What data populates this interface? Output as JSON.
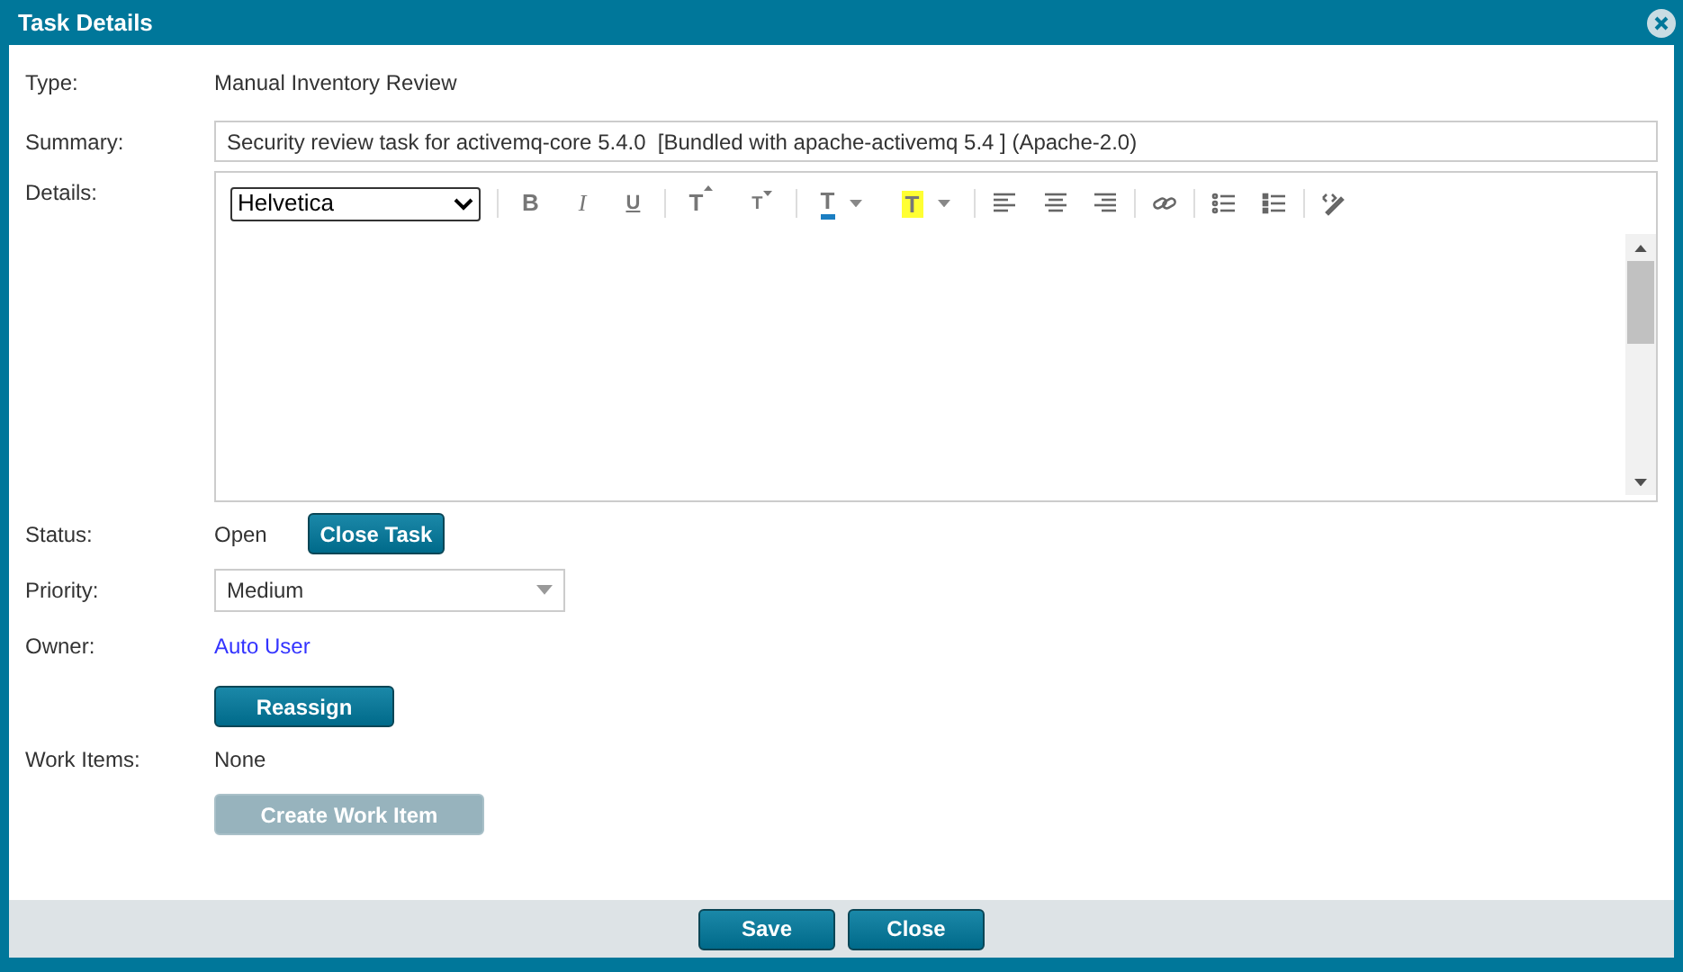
{
  "window": {
    "title": "Task Details"
  },
  "fields": {
    "type": {
      "label": "Type:",
      "value": "Manual Inventory Review"
    },
    "summary": {
      "label": "Summary:",
      "value": "Security review task for activemq-core 5.4.0  [Bundled with apache-activemq 5.4 ] (Apache-2.0)"
    },
    "details": {
      "label": "Details:",
      "font": "Helvetica",
      "toolbar": [
        [
          {
            "kind": "bold",
            "label": "B"
          },
          {
            "kind": "italic",
            "label": "I"
          },
          {
            "kind": "underline",
            "label": "U"
          }
        ],
        [
          {
            "kind": "grow",
            "label": "T"
          },
          {
            "kind": "shrink",
            "label": "T"
          }
        ],
        [
          {
            "kind": "text-color",
            "label": "T"
          },
          {
            "kind": "highlight",
            "label": "T"
          }
        ],
        [
          {
            "kind": "align-left"
          },
          {
            "kind": "align-center"
          },
          {
            "kind": "align-right"
          }
        ],
        [
          {
            "kind": "link"
          }
        ],
        [
          {
            "kind": "ordered-list"
          },
          {
            "kind": "bullet-list"
          }
        ],
        [
          {
            "kind": "source"
          }
        ]
      ]
    },
    "status": {
      "label": "Status:",
      "value": "Open",
      "button": {
        "label": "Close Task",
        "disabled": false
      }
    },
    "priority": {
      "label": "Priority:",
      "value": "Medium"
    },
    "owner": {
      "label": "Owner:",
      "value": "Auto User",
      "button": {
        "label": "Reassign",
        "disabled": false
      }
    },
    "work_items": {
      "label": "Work Items:",
      "value": "None",
      "button": {
        "label": "Create Work Item",
        "disabled": true
      }
    }
  },
  "footer": {
    "buttons": [
      "Save",
      "Close"
    ]
  }
}
